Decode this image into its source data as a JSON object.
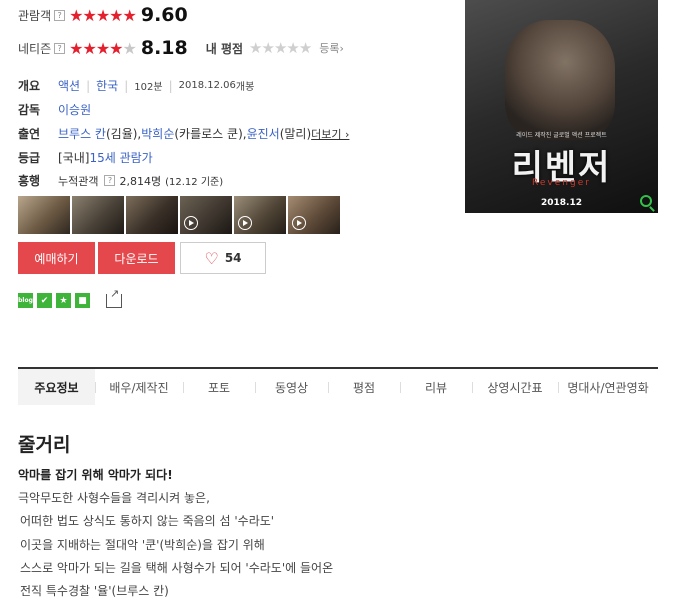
{
  "ratings": {
    "audience": {
      "label": "관람객",
      "help": "?",
      "stars": "★★★★★",
      "stars_off": "",
      "score": "9.60"
    },
    "netizen": {
      "label": "네티즌",
      "help": "?",
      "stars": "★★★★",
      "stars_off": "★",
      "score": "8.18"
    },
    "my_rating": {
      "label": "내 평점",
      "stars": "★★★★★",
      "register": "등록›"
    }
  },
  "info": {
    "overview": {
      "key": "개요",
      "genre": "액션",
      "country": "한국",
      "runtime": "102분",
      "release_date": "2018.12.06",
      "release_suffix": " 개봉"
    },
    "director": {
      "key": "감독",
      "name": "이승원"
    },
    "cast": {
      "key": "출연",
      "actor1": "브루스 칸",
      "role1": "(김율), ",
      "actor2": "박희순",
      "role2": "(카를로스 쿤), ",
      "actor3": "윤진서",
      "role3": "(말리) ",
      "more": "더보기 ›"
    },
    "grade": {
      "key": "등급",
      "prefix": "[국내] ",
      "rating": "15세 관람가"
    },
    "audience_count": {
      "key": "흥행",
      "label": "누적관객",
      "help": "?",
      "count": "2,814명",
      "date": "(12.12 기준)"
    }
  },
  "actions": {
    "reserve": "예매하기",
    "download": "다운로드",
    "like_count": "54"
  },
  "sns": {
    "blog": "blog"
  },
  "poster": {
    "tagline": "레이드 제작진 글로벌 액션 프로젝트",
    "title": "리벤저",
    "subtitle": "Revenger",
    "date": "2018.12"
  },
  "tabs": [
    "주요정보",
    "배우/제작진",
    "포토",
    "동영상",
    "평점",
    "리뷰",
    "상영시간표",
    "명대사/연관영화"
  ],
  "synopsis": {
    "title": "줄거리",
    "headline": "악마를 잡기 위해 악마가 되다!",
    "lines": [
      "극악무도한 사형수들을 격리시켜 놓은,",
      "어떠한 법도 상식도 통하지 않는 죽음의 섬 '수라도'",
      "이곳을 지배하는 절대악 '쿤'(박희순)을 잡기 위해",
      "스스로 악마가 되는 길을 택해 사형수가 되어 '수라도'에 들어온",
      "전직 특수경찰 '율'(브루스 칸)"
    ]
  },
  "colors": {
    "accent_red": "#e4474c",
    "link_blue": "#3b63c4"
  }
}
